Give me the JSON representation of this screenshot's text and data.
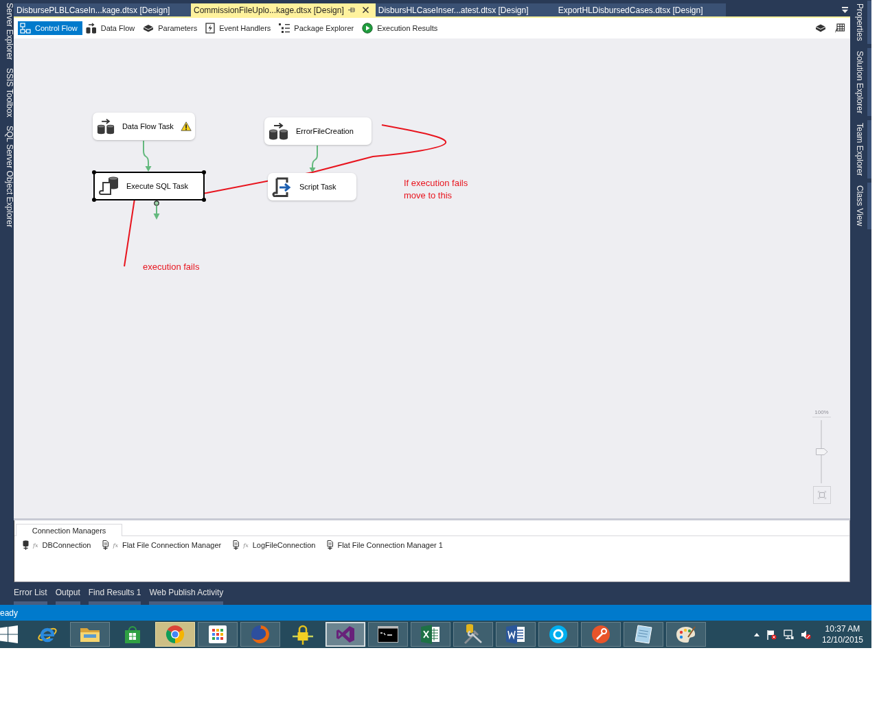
{
  "left_panels": [
    "Server Explorer",
    "SSIS Toolbox",
    "SQL Server Object Explorer"
  ],
  "document_tabs": [
    {
      "label": "DisbursePLBLCaseIn...kage.dtsx [Design]",
      "selected": false
    },
    {
      "label": "CommissionFileUplo...kage.dtsx [Design]",
      "selected": true
    },
    {
      "label": "DisbursHLCaseInser...atest.dtsx [Design]",
      "selected": false
    },
    {
      "label": "ExportHLDisbursedCases.dtsx [Design]",
      "selected": false
    }
  ],
  "designer_tabs": [
    {
      "label": "Control Flow",
      "selected": true
    },
    {
      "label": "Data Flow",
      "selected": false
    },
    {
      "label": "Parameters",
      "selected": false
    },
    {
      "label": "Event Handlers",
      "selected": false
    },
    {
      "label": "Package Explorer",
      "selected": false
    },
    {
      "label": "Execution Results",
      "selected": false
    }
  ],
  "canvas": {
    "tasks": [
      {
        "name": "Data Flow Task",
        "kind": "data_flow",
        "warning": true,
        "selected": false
      },
      {
        "name": "ErrorFileCreation",
        "kind": "data_flow",
        "warning": false,
        "selected": false
      },
      {
        "name": "Execute SQL Task",
        "kind": "execute_sql",
        "warning": false,
        "selected": true
      },
      {
        "name": "Script Task",
        "kind": "script",
        "warning": false,
        "selected": false
      }
    ],
    "annotations": [
      {
        "text": "If execution fails\nmove to this"
      },
      {
        "text": "execution fails"
      }
    ],
    "zoom": {
      "label": "100%",
      "level": 0.5
    }
  },
  "connection_managers": {
    "title": "Connection Managers",
    "items": [
      {
        "name": "DBConnection",
        "kind": "database",
        "badge": "fx"
      },
      {
        "name": "Flat File Connection Manager",
        "kind": "flat_file",
        "badge": "fx"
      },
      {
        "name": "LogFileConnection",
        "kind": "flat_file",
        "badge": "fx"
      },
      {
        "name": "Flat File Connection Manager 1",
        "kind": "flat_file"
      }
    ]
  },
  "tool_tabs": [
    "Error List",
    "Output",
    "Find Results 1",
    "Web Publish Activity"
  ],
  "right_panels": [
    "Properties",
    "Solution Explorer",
    "Team Explorer",
    "Class View"
  ],
  "status_bar": {
    "text": "eady"
  },
  "taskbar": {
    "apps": [
      {
        "running": false,
        "selected": false,
        "attention": false
      },
      {
        "running": true,
        "selected": false,
        "attention": false
      },
      {
        "running": false,
        "selected": false,
        "attention": false
      },
      {
        "running": true,
        "selected": false,
        "attention": true
      },
      {
        "running": true,
        "selected": false,
        "attention": false
      },
      {
        "running": true,
        "selected": false,
        "attention": false
      },
      {
        "running": false,
        "selected": false,
        "attention": false
      },
      {
        "running": true,
        "selected": true,
        "attention": false
      },
      {
        "running": true,
        "selected": false,
        "attention": false
      },
      {
        "running": true,
        "selected": false,
        "attention": false
      },
      {
        "running": true,
        "selected": false,
        "attention": false
      },
      {
        "running": true,
        "selected": false,
        "attention": false
      },
      {
        "running": true,
        "selected": false,
        "attention": false
      },
      {
        "running": true,
        "selected": false,
        "attention": false
      },
      {
        "running": true,
        "selected": false,
        "attention": false
      },
      {
        "running": true,
        "selected": false,
        "attention": false
      }
    ],
    "time": "10:37 AM",
    "date": "12/10/2015"
  }
}
